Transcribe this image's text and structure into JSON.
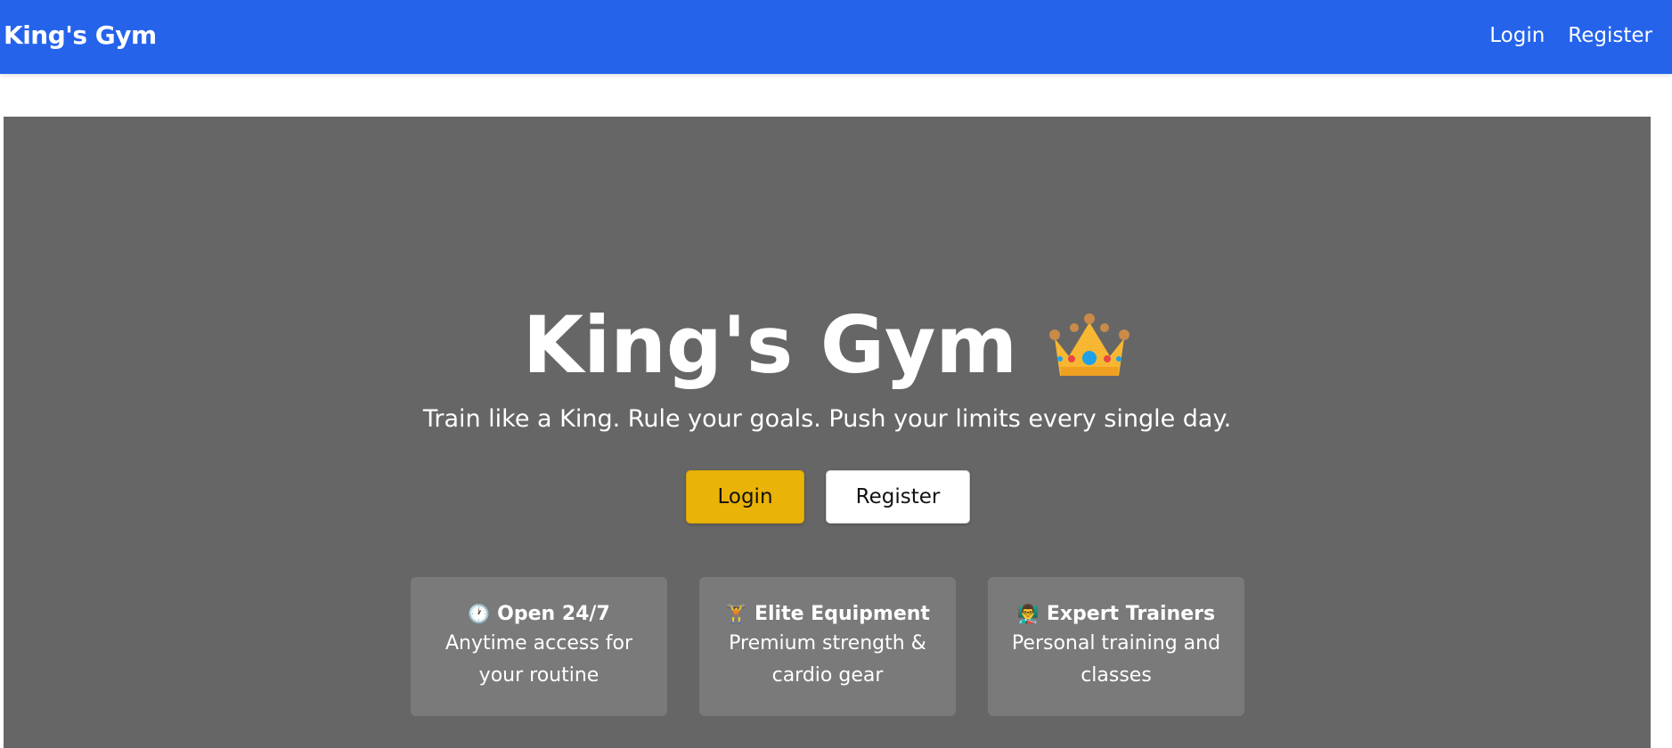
{
  "navbar": {
    "brand": "King's Gym",
    "links": [
      {
        "label": "Login"
      },
      {
        "label": "Register"
      }
    ]
  },
  "hero": {
    "title": "King's Gym",
    "title_icon": "crown-icon",
    "subtitle": "Train like a King. Rule your goals. Push your limits every single day.",
    "buttons": {
      "login": "Login",
      "register": "Register"
    },
    "features": [
      {
        "emoji": "🕐",
        "icon": "clock-icon",
        "title": "Open 24/7",
        "description": "Anytime access for your routine"
      },
      {
        "emoji": "🏋️",
        "icon": "weightlifter-icon",
        "title": "Elite Equipment",
        "description": "Premium strength & cardio gear"
      },
      {
        "emoji": "👨‍🏫",
        "icon": "trainer-icon",
        "title": "Expert Trainers",
        "description": "Personal training and classes"
      }
    ]
  },
  "colors": {
    "navbar": "#2563eb",
    "hero_bg": "#666666",
    "card_bg": "#7a7a7a",
    "accent_button": "#eab308"
  }
}
